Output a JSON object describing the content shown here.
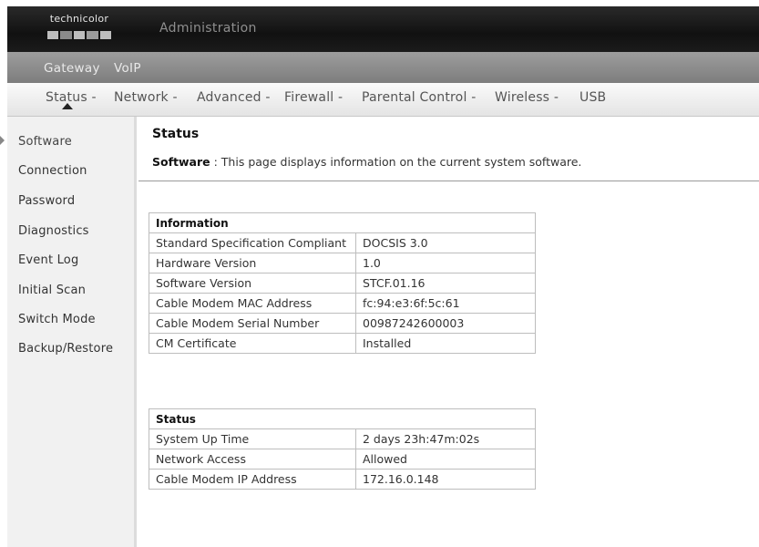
{
  "header": {
    "logo_text": "technicolor",
    "title": "Administration"
  },
  "top_nav": {
    "items": [
      "Gateway",
      "VoIP"
    ]
  },
  "sub_nav": {
    "items": [
      "Status -",
      "Network -",
      "Advanced -",
      "Firewall -",
      "Parental Control -",
      "Wireless -",
      "USB"
    ],
    "active": "Status -"
  },
  "sidebar": {
    "items": [
      "Software",
      "Connection",
      "Password",
      "Diagnostics",
      "Event Log",
      "Initial Scan",
      "Switch Mode",
      "Backup/Restore"
    ],
    "active": "Software"
  },
  "main": {
    "title": "Status",
    "desc_label": "Software",
    "desc_text": " :  This page displays information on the current system software."
  },
  "information_table": {
    "header": "Information",
    "rows": [
      [
        "Standard Specification Compliant",
        "DOCSIS 3.0"
      ],
      [
        "Hardware Version",
        "1.0"
      ],
      [
        "Software Version",
        "STCF.01.16"
      ],
      [
        "Cable Modem MAC Address",
        "fc:94:e3:6f:5c:61"
      ],
      [
        "Cable Modem Serial Number",
        "00987242600003"
      ],
      [
        "CM Certificate",
        "Installed"
      ]
    ]
  },
  "status_table": {
    "header": "Status",
    "rows": [
      [
        "System Up Time",
        "2 days 23h:47m:02s"
      ],
      [
        "Network Access",
        "Allowed"
      ],
      [
        "Cable Modem IP Address",
        "172.16.0.148"
      ]
    ]
  },
  "colors": {
    "header_bg": "#1b1b1b",
    "gateway_bar": "#8a8a8a",
    "sidebar_bg": "#f1f1f1"
  }
}
